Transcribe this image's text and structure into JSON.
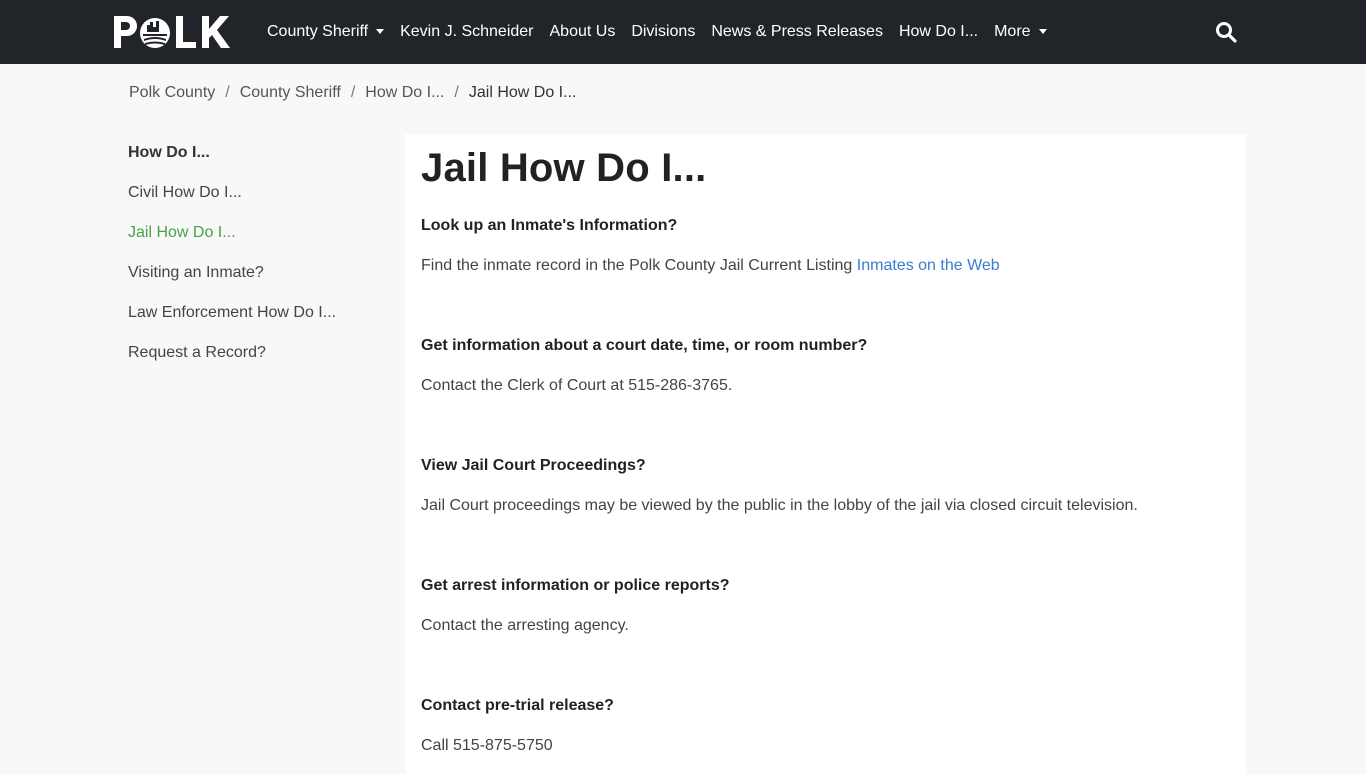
{
  "header": {
    "logo_text": "POLK",
    "nav": [
      {
        "label": "County Sheriff",
        "dropdown": true
      },
      {
        "label": "Kevin J. Schneider",
        "dropdown": false
      },
      {
        "label": "About Us",
        "dropdown": false
      },
      {
        "label": "Divisions",
        "dropdown": false
      },
      {
        "label": "News & Press Releases",
        "dropdown": false
      },
      {
        "label": "How Do I...",
        "dropdown": false
      },
      {
        "label": "More",
        "dropdown": true
      }
    ],
    "search_icon": "search-icon",
    "background": "#212529"
  },
  "breadcrumb": [
    {
      "label": "Polk County"
    },
    {
      "label": "County Sheriff"
    },
    {
      "label": "How Do I..."
    },
    {
      "label": "Jail How Do I..."
    }
  ],
  "sidebar": {
    "heading": "How Do I...",
    "items": [
      {
        "label": "Civil How Do I..."
      },
      {
        "label": "Jail How Do I..."
      },
      {
        "label": "Visiting an Inmate?"
      },
      {
        "label": "Law Enforcement How Do I..."
      },
      {
        "label": "Request a Record?"
      }
    ],
    "active_color": "#4aa14a"
  },
  "main": {
    "title": "Jail How Do I...",
    "sections": [
      {
        "question": "Look up an Inmate's Information?",
        "answer": "Find the inmate record in the Polk County Jail Current Listing",
        "link": "Inmates on the Web"
      },
      {
        "question": "Get information about a court date, time, or room number?",
        "answer": "Contact the Clerk of Court at 515-286-3765."
      },
      {
        "question": "View Jail Court Proceedings?",
        "answer": "Jail Court proceedings may be viewed by the public in the lobby of the jail via closed circuit television."
      },
      {
        "question": "Get arrest information or police reports?",
        "answer": "Contact the arresting agency."
      },
      {
        "question": "Contact pre-trial release?",
        "answer": "Call 515-875-5750"
      }
    ],
    "link_color": "#3a7bd5"
  }
}
